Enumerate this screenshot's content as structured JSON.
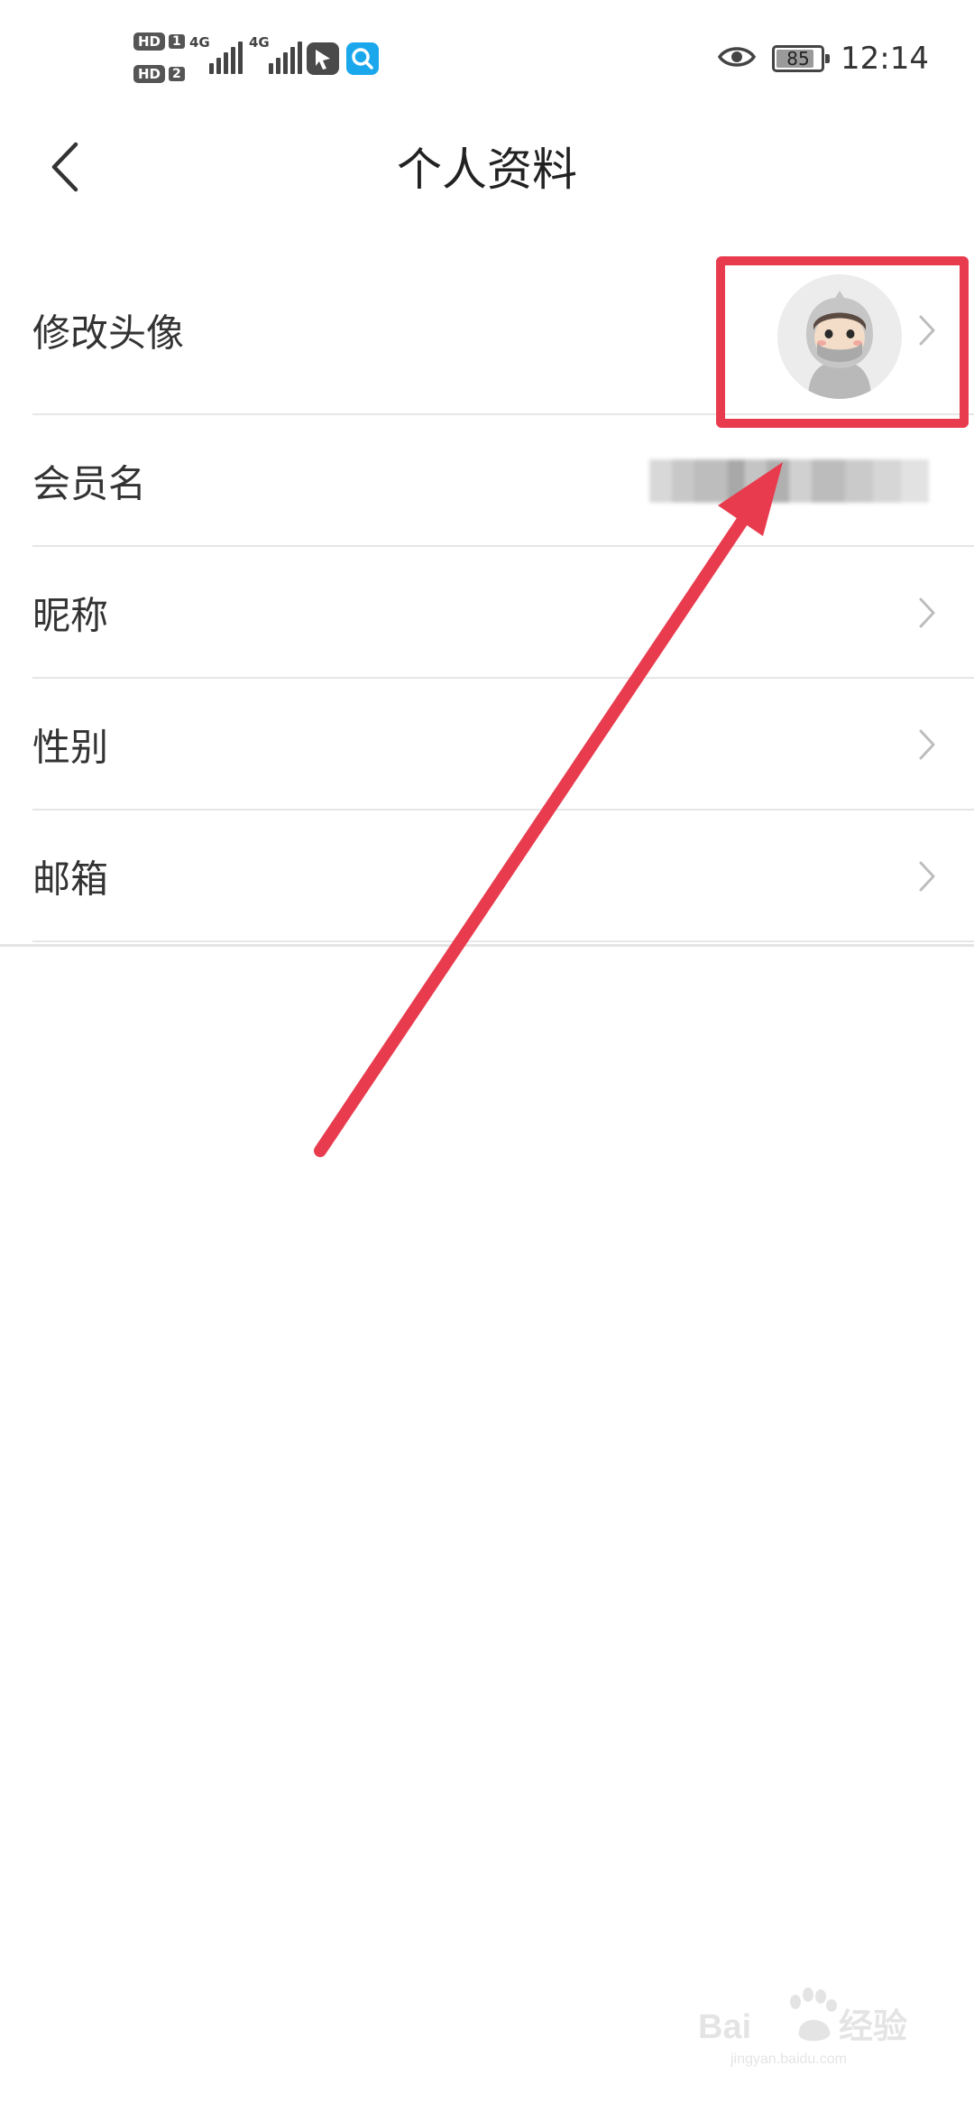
{
  "status_bar": {
    "sim1_label": "HD",
    "sim1_num": "1",
    "sim2_label": "HD",
    "sim2_num": "2",
    "network_1": "4G",
    "network_2": "4G",
    "battery_percent": 85,
    "battery_text": "85",
    "time": "12:14",
    "icons": [
      "eye-icon",
      "battery-icon",
      "app-notification-icon",
      "search-app-icon"
    ]
  },
  "header": {
    "title": "个人资料",
    "back_icon": "chevron-left-icon"
  },
  "profile_rows": [
    {
      "label": "修改头像",
      "type": "avatar",
      "chevron": true
    },
    {
      "label": "会员名",
      "type": "obscured-value",
      "chevron": false
    },
    {
      "label": "昵称",
      "type": "link",
      "chevron": true
    },
    {
      "label": "性别",
      "type": "link",
      "chevron": true
    },
    {
      "label": "邮箱",
      "type": "link",
      "chevron": true
    }
  ],
  "annotation": {
    "color": "#e83c4e",
    "shapes": [
      "highlight-box",
      "arrow"
    ]
  },
  "watermark": {
    "brand": "Baidu",
    "suffix": "经验",
    "domain": "jingyan.baidu.com"
  }
}
